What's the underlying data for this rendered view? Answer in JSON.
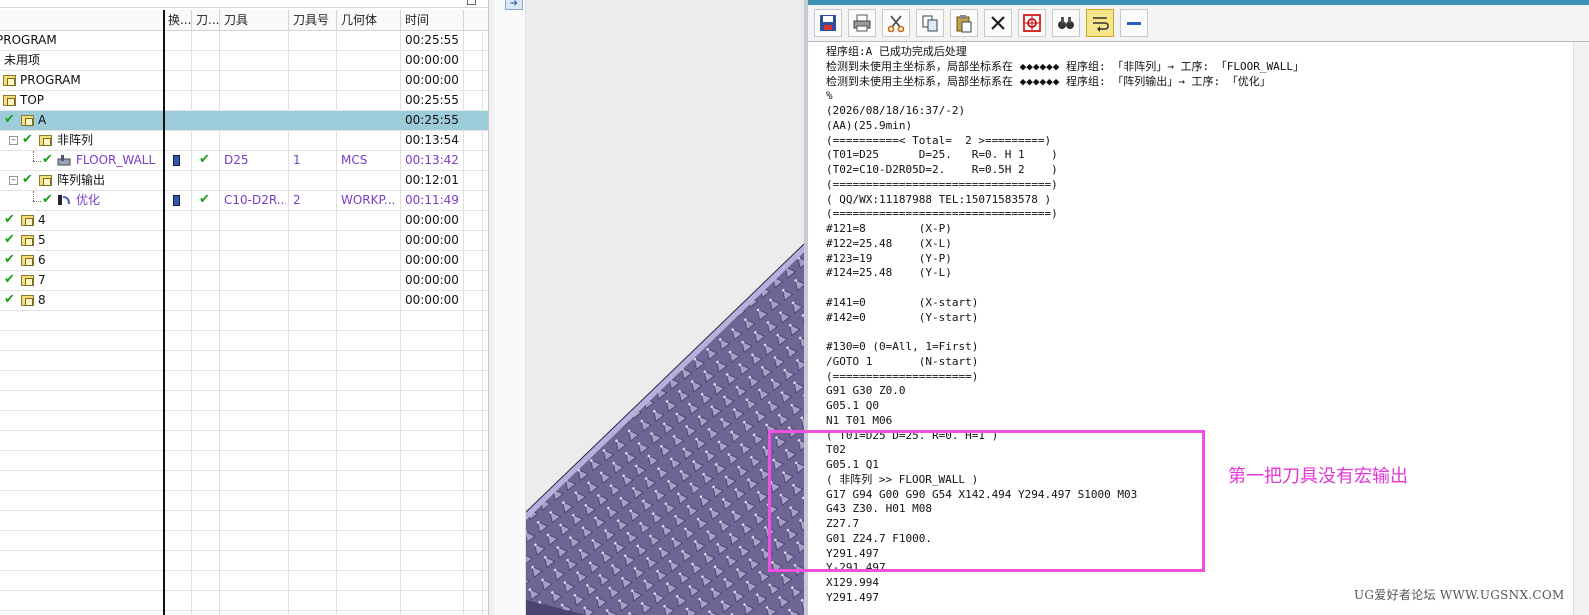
{
  "navigator": {
    "columns": [
      "换...",
      "刀...",
      "刀具",
      "刀具号",
      "几何体",
      "时间"
    ],
    "rows": [
      {
        "name": "PROGRAM",
        "time": "00:25:55"
      },
      {
        "name": "未用项",
        "time": "00:00:00"
      },
      {
        "name": "PROGRAM",
        "time": "00:00:00"
      },
      {
        "name": "TOP",
        "time": "00:25:55"
      },
      {
        "name": "A",
        "time": "00:25:55",
        "selected": true
      },
      {
        "name": "非阵列",
        "time": "00:13:54"
      },
      {
        "name": "FLOOR_WALL",
        "tool": "D25",
        "tool_no": "1",
        "geometry": "MCS",
        "time": "00:13:42"
      },
      {
        "name": "阵列输出",
        "time": "00:12:01"
      },
      {
        "name": "优化",
        "tool": "C10-D2R...",
        "tool_no": "2",
        "geometry": "WORKP...",
        "time": "00:11:49"
      },
      {
        "name": "4",
        "time": "00:00:00"
      },
      {
        "name": "5",
        "time": "00:00:00"
      },
      {
        "name": "6",
        "time": "00:00:00"
      },
      {
        "name": "7",
        "time": "00:00:00"
      },
      {
        "name": "8",
        "time": "00:00:00"
      }
    ]
  },
  "toolbar": {
    "buttons": [
      "save-icon",
      "print-icon",
      "cut-icon",
      "copy-icon",
      "paste-icon",
      "delete-icon",
      "target-icon",
      "find-icon",
      "wrap-icon",
      "minimize-icon"
    ]
  },
  "listing": {
    "lines": [
      "程序组:A 已成功完成后处理",
      "检测到未使用主坐标系，局部坐标系在 ◆◆◆◆◆◆ 程序组: 「非阵列」→ 工序: 「FLOOR_WALL」",
      "检测到未使用主坐标系，局部坐标系在 ◆◆◆◆◆◆ 程序组: 「阵列输出」→ 工序: 「优化」",
      "%",
      "(2026/08/18/16:37/-2)",
      "(AA)(25.9min)",
      "(==========< Total=  2 >=========)",
      "(T01=D25      D=25.   R=0. H 1    )",
      "(T02=C10-D2R05D=2.    R=0.5H 2    )",
      "(=================================)",
      "( QQ/WX:11187988 TEL:15071583578 )",
      "(=================================)",
      "#121=8        (X-P)",
      "#122=25.48    (X-L)",
      "#123=19       (Y-P)",
      "#124=25.48    (Y-L)",
      "",
      "#141=0        (X-start)",
      "#142=0        (Y-start)",
      "",
      "#130=0 (0=All, 1=First)",
      "/GOTO 1       (N-start)",
      "(=====================)",
      "G91 G30 Z0.0",
      "G05.1 Q0",
      "N1 T01 M06",
      "( T01=D25 D=25. R=0. H=1 )",
      "T02",
      "G05.1 Q1",
      "( 非阵列 >> FLOOR_WALL )",
      "G17 G94 G00 G90 G54 X142.494 Y294.497 S1000 M03",
      "G43 Z30. H01 M08",
      "Z27.7",
      "G01 Z24.7 F1000.",
      "Y291.497",
      "Y-291.497",
      "X129.994",
      "Y291.497"
    ]
  },
  "annotation": {
    "note": "第一把刀具没有宏输出",
    "color": "#f14fe0"
  },
  "watermark": "UG爱好者论坛 WWW.UGSNX.COM"
}
